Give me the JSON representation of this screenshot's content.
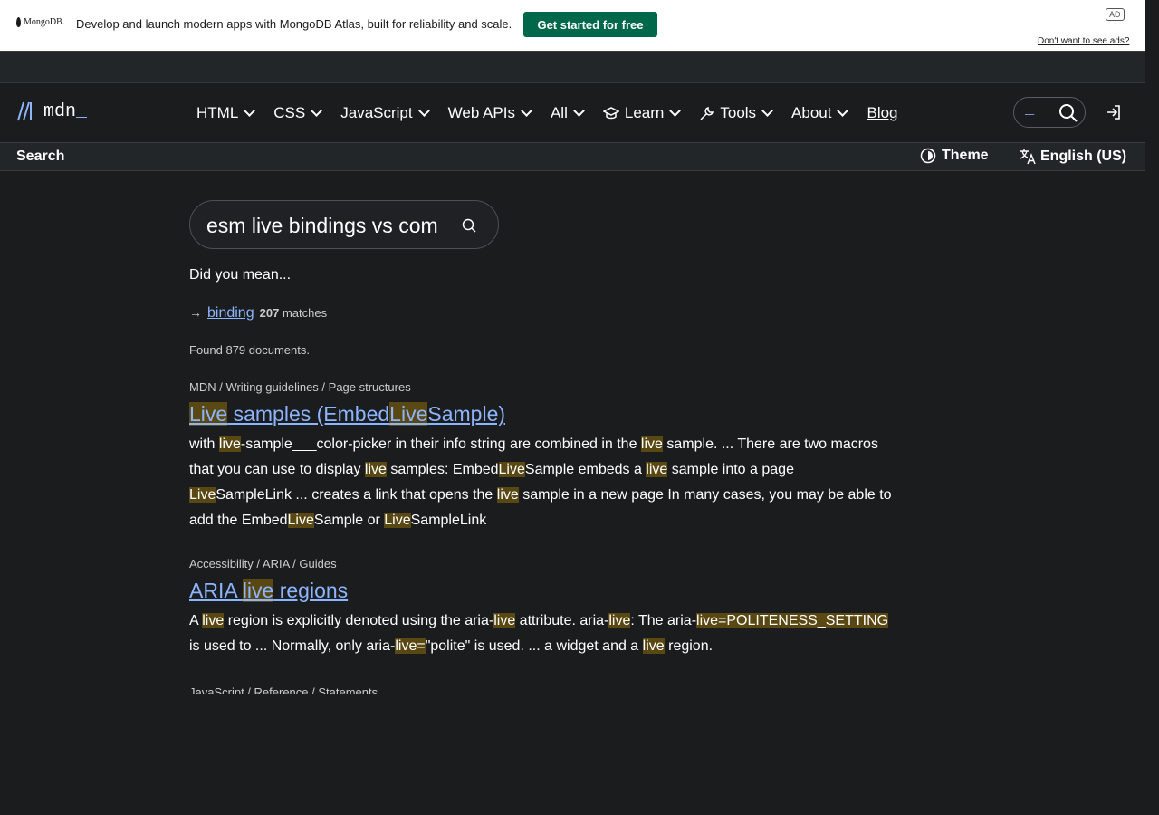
{
  "ad": {
    "brand": "MongoDB.",
    "text": "Develop and launch modern apps with MongoDB Atlas, built for reliability and scale.",
    "cta": "Get started for free",
    "badge": "AD",
    "optout": "Don't want to see ads?"
  },
  "nav": {
    "logo": "mdn",
    "items": [
      {
        "label": "HTML"
      },
      {
        "label": "CSS"
      },
      {
        "label": "JavaScript"
      },
      {
        "label": "Web APIs"
      },
      {
        "label": "All"
      },
      {
        "label": "Learn",
        "icon": "graduation-cap-icon"
      },
      {
        "label": "Tools",
        "icon": "wrench-icon"
      },
      {
        "label": "About"
      }
    ],
    "blog": "Blog"
  },
  "subbar": {
    "title": "Search",
    "theme": "Theme",
    "language": "English (US)"
  },
  "search": {
    "query": "esm live bindings vs com",
    "did_you_mean": "Did you mean...",
    "suggestion": "binding",
    "suggestion_count": "207",
    "suggestion_suffix": "matches",
    "found": "Found 879 documents."
  },
  "results": [
    {
      "breadcrumb": "MDN / Writing guidelines / Page structures",
      "title_html": "<mark>Live</mark> samples (Embed<mark>Live</mark>Sample)",
      "snippet_html": "with <mark>live</mark>-sample___color-picker in their info string are combined in the <mark>live</mark> sample. ... There are two macros that you can use to display <mark>live</mark> samples: Embed<mark>Live</mark>Sample embeds a <mark>live</mark> sample into a page <mark>Live</mark>SampleLink ... creates a link that opens the <mark>live</mark> sample in a new page In many cases, you may be able to add the Embed<mark>Live</mark>Sample or <mark>Live</mark>SampleLink"
    },
    {
      "breadcrumb": "Accessibility / ARIA / Guides",
      "title_html": "ARIA <mark>live</mark> regions",
      "snippet_html": "A <mark>live</mark> region is explicitly denoted using the aria-<mark>live</mark> attribute. aria-<mark>live</mark>: The aria-<mark>live=POLITENESS_SETTING</mark> is used to ... Normally, only aria-<mark>live=</mark>\"polite\" is used. ... a widget and a <mark>live</mark> region."
    }
  ],
  "next_breadcrumb": "JavaScript / Reference / Statements",
  "colors": {
    "background": "#1b1c1e",
    "link": "#8cb4ff",
    "highlight": "#5a4812",
    "ad_cta": "#00684a"
  }
}
